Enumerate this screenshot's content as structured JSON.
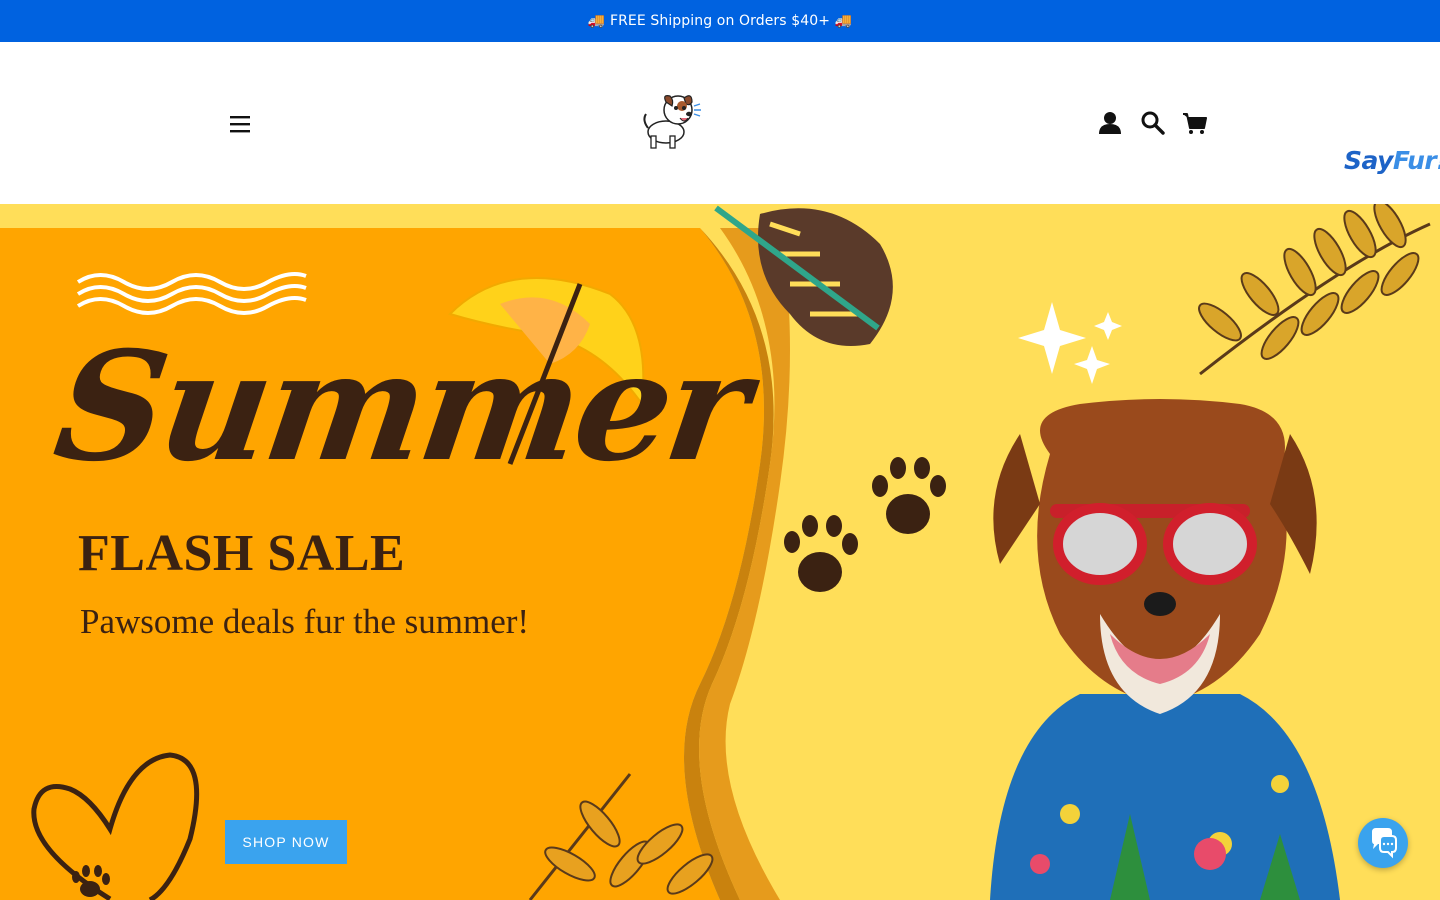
{
  "announcement": {
    "text": "🚚 FREE Shipping on Orders $40+ 🚚"
  },
  "header": {
    "menu_icon": "hamburger-menu-icon",
    "logo": {
      "text_a": "Say",
      "text_b": "Fur!"
    },
    "icons": [
      "account-icon",
      "search-icon",
      "cart-icon"
    ]
  },
  "hero": {
    "title": "Summer",
    "subtitle": "FLASH SALE",
    "tagline": "Pawsome deals fur the summer!",
    "cta_label": "SHOP NOW"
  },
  "chat": {
    "icon": "chat-icon"
  },
  "colors": {
    "announcement_bg": "#0062e0",
    "hero_orange": "#ffa500",
    "hero_yellow": "#ffde59",
    "text_brown": "#3b2212",
    "button_blue": "#3aa3ee"
  }
}
